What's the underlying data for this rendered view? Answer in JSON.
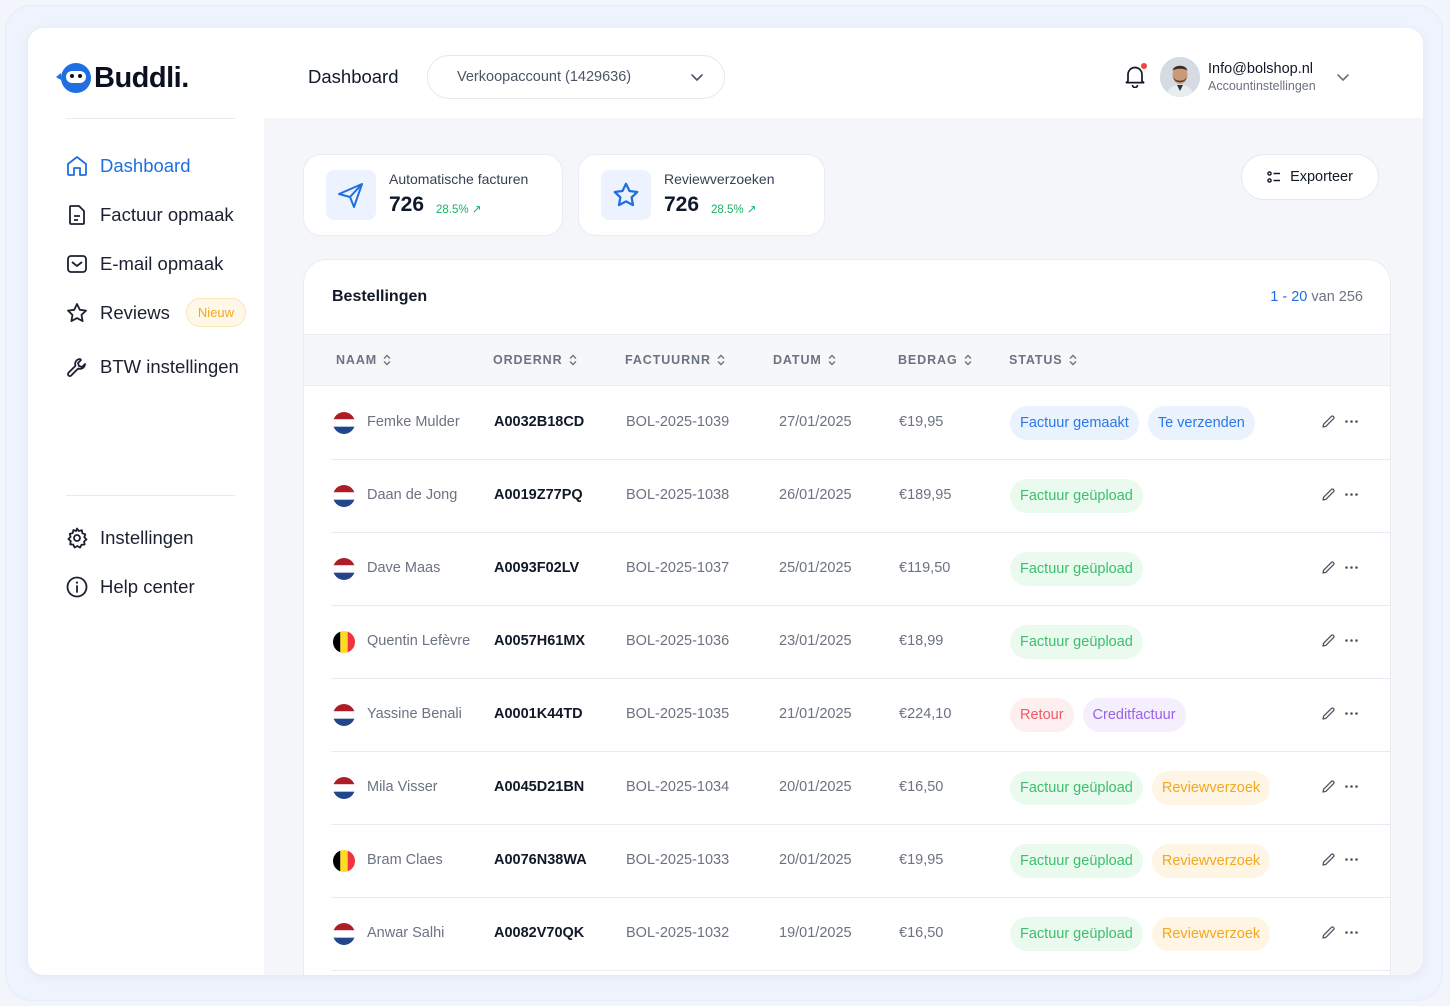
{
  "brand": {
    "name": "Buddli."
  },
  "sidebar": {
    "items": [
      {
        "label": "Dashboard",
        "icon": "home-icon",
        "active": true
      },
      {
        "label": "Factuur opmaak",
        "icon": "document-icon"
      },
      {
        "label": "E-mail opmaak",
        "icon": "mail-icon"
      },
      {
        "label": "Reviews",
        "icon": "star-icon",
        "badge": "Nieuw"
      },
      {
        "label": "BTW instellingen",
        "icon": "wrench-icon"
      }
    ],
    "bottom_items": [
      {
        "label": "Instellingen",
        "icon": "gear-icon"
      },
      {
        "label": "Help center",
        "icon": "info-icon"
      }
    ]
  },
  "header": {
    "title": "Dashboard",
    "account_select": "Verkoopaccount (1429636)",
    "user_email": "Info@bolshop.nl",
    "user_sub": "Accountinstellingen"
  },
  "stats": [
    {
      "label": "Automatische facturen",
      "value": "726",
      "delta": "28.5%",
      "icon": "send-icon"
    },
    {
      "label": "Reviewverzoeken",
      "value": "726",
      "delta": "28.5%",
      "icon": "star-icon"
    }
  ],
  "export_label": "Exporteer",
  "table": {
    "title": "Bestellingen",
    "pagination": {
      "range": "1 - 20",
      "suffix": " van 256"
    },
    "columns": [
      "NAAM",
      "ORDERNR",
      "FACTUURNR",
      "DATUM",
      "BEDRAG",
      "STATUS"
    ],
    "rows": [
      {
        "flag": "nl",
        "name": "Femke Mulder",
        "order": "A0032B18CD",
        "invoice": "BOL-2025-1039",
        "date": "27/01/2025",
        "amount": "€19,95",
        "tags": [
          {
            "label": "Factuur gemaakt",
            "color": "blue"
          },
          {
            "label": "Te verzenden",
            "color": "blue"
          }
        ]
      },
      {
        "flag": "nl",
        "name": "Daan de Jong",
        "order": "A0019Z77PQ",
        "invoice": "BOL-2025-1038",
        "date": "26/01/2025",
        "amount": "€189,95",
        "tags": [
          {
            "label": "Factuur geüpload",
            "color": "green"
          }
        ]
      },
      {
        "flag": "nl",
        "name": "Dave Maas",
        "order": "A0093F02LV",
        "invoice": "BOL-2025-1037",
        "date": "25/01/2025",
        "amount": "€119,50",
        "tags": [
          {
            "label": "Factuur geüpload",
            "color": "green"
          }
        ]
      },
      {
        "flag": "be",
        "name": "Quentin Lefèvre",
        "order": "A0057H61MX",
        "invoice": "BOL-2025-1036",
        "date": "23/01/2025",
        "amount": "€18,99",
        "tags": [
          {
            "label": "Factuur geüpload",
            "color": "green"
          }
        ]
      },
      {
        "flag": "nl",
        "name": "Yassine Benali",
        "order": "A0001K44TD",
        "invoice": "BOL-2025-1035",
        "date": "21/01/2025",
        "amount": "€224,10",
        "tags": [
          {
            "label": "Retour",
            "color": "red"
          },
          {
            "label": "Creditfactuur",
            "color": "purple"
          }
        ]
      },
      {
        "flag": "nl",
        "name": "Mila Visser",
        "order": "A0045D21BN",
        "invoice": "BOL-2025-1034",
        "date": "20/01/2025",
        "amount": "€16,50",
        "tags": [
          {
            "label": "Factuur geüpload",
            "color": "green"
          },
          {
            "label": "Reviewverzoek",
            "color": "orange"
          }
        ]
      },
      {
        "flag": "be",
        "name": "Bram Claes",
        "order": "A0076N38WA",
        "invoice": "BOL-2025-1033",
        "date": "20/01/2025",
        "amount": "€19,95",
        "tags": [
          {
            "label": "Factuur geüpload",
            "color": "green"
          },
          {
            "label": "Reviewverzoek",
            "color": "orange"
          }
        ]
      },
      {
        "flag": "nl",
        "name": "Anwar Salhi",
        "order": "A0082V70QK",
        "invoice": "BOL-2025-1032",
        "date": "19/01/2025",
        "amount": "€16,50",
        "tags": [
          {
            "label": "Factuur geüpload",
            "color": "green"
          },
          {
            "label": "Reviewverzoek",
            "color": "orange"
          }
        ]
      }
    ]
  },
  "colors": {
    "accent": "#1f6fe0",
    "positive": "#16b364"
  }
}
